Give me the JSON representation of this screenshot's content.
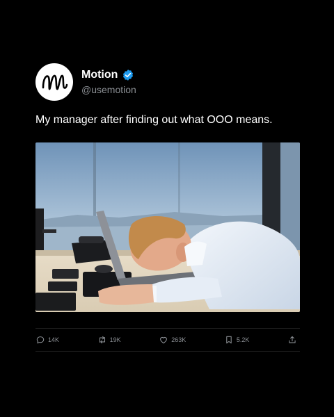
{
  "tweet": {
    "name": "Motion",
    "handle": "@usemotion",
    "text": "My manager after finding out what OOO means.",
    "verified": true
  },
  "media": {
    "description_icon": "photo"
  },
  "actions": {
    "reply_count": "14K",
    "retweet_count": "19K",
    "like_count": "263K",
    "bookmark_count": "5.2K"
  },
  "colors": {
    "background": "#000000",
    "verified_badge": "#1d9bf0",
    "secondary_text": "#8b8f94"
  }
}
